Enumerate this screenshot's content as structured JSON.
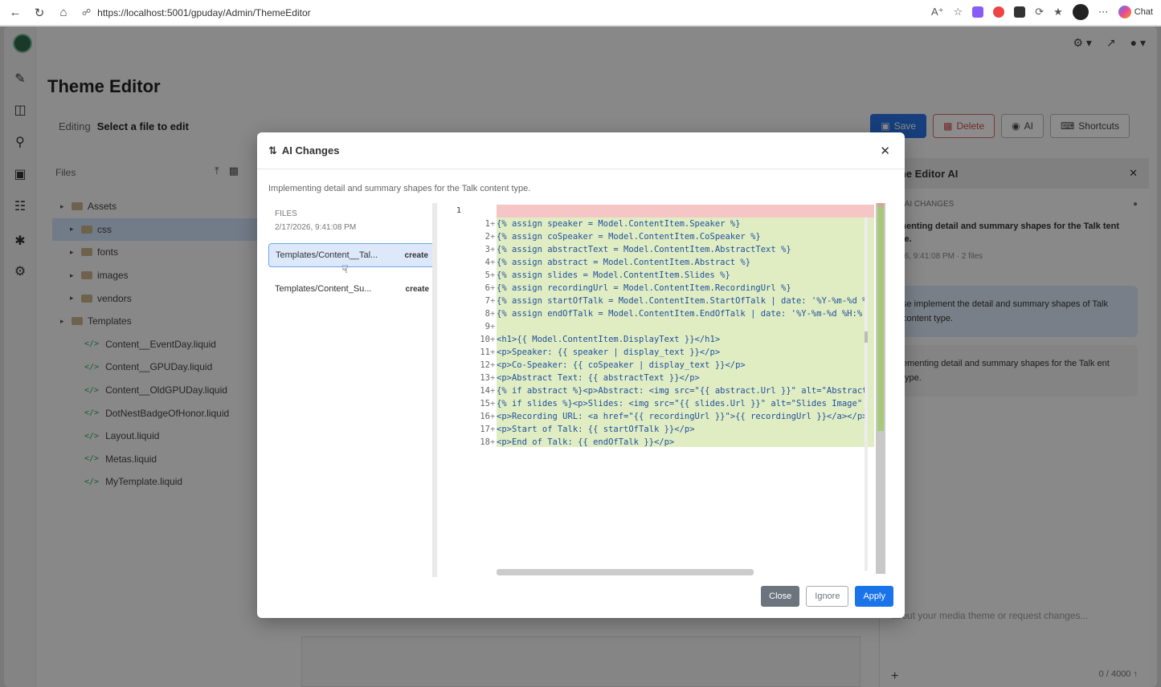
{
  "browser": {
    "url": "https://localhost:5001/gpuday/Admin/ThemeEditor",
    "chat_label": "Chat"
  },
  "app": {
    "page_title": "Theme Editor",
    "editing_label": "Editing",
    "editing_value": "Select a file to edit",
    "files_header": "Files",
    "tree": [
      {
        "label": "Assets",
        "type": "folder",
        "level": 0
      },
      {
        "label": "css",
        "type": "folder",
        "level": 1,
        "active": true
      },
      {
        "label": "fonts",
        "type": "folder",
        "level": 1
      },
      {
        "label": "images",
        "type": "folder",
        "level": 1
      },
      {
        "label": "vendors",
        "type": "folder",
        "level": 1
      },
      {
        "label": "Templates",
        "type": "folder",
        "level": 0
      },
      {
        "label": "Content__EventDay.liquid",
        "type": "file",
        "level": 1
      },
      {
        "label": "Content__GPUDay.liquid",
        "type": "file",
        "level": 1
      },
      {
        "label": "Content__OldGPUDay.liquid",
        "type": "file",
        "level": 1
      },
      {
        "label": "DotNestBadgeOfHonor.liquid",
        "type": "file",
        "level": 1
      },
      {
        "label": "Layout.liquid",
        "type": "file",
        "level": 1
      },
      {
        "label": "Metas.liquid",
        "type": "file",
        "level": 1
      },
      {
        "label": "MyTemplate.liquid",
        "type": "file",
        "level": 1
      }
    ],
    "toolbar": {
      "save": "Save",
      "delete": "Delete",
      "ai": "AI",
      "shortcuts": "Shortcuts"
    },
    "ai_panel": {
      "title": "eme Editor AI",
      "section": "ND AI CHANGES",
      "item_text": "lementing detail and summary shapes for the Talk tent type.",
      "item_ts": "2026, 9:41:08 PM · 2 files",
      "message": "se implement the detail and summary shapes of Talk content type.",
      "response": "ementing detail and summary shapes for the Talk ent type.",
      "input_placeholder": "about your media theme or request changes...",
      "counter": "0 / 4000"
    }
  },
  "modal": {
    "title": "AI Changes",
    "description": "Implementing detail and summary shapes for the Talk content type.",
    "files_label": "FILES",
    "date": "2/17/2026, 9:41:08 PM",
    "files": [
      {
        "name": "Templates/Content__Tal...",
        "action": "create",
        "selected": true
      },
      {
        "name": "Templates/Content_Su...",
        "action": "create",
        "selected": false
      }
    ],
    "original_line": "1",
    "diff_lines": [
      {
        "num": "1",
        "code": "{% assign speaker = Model.ContentItem.Speaker %}"
      },
      {
        "num": "2",
        "code": "{% assign coSpeaker = Model.ContentItem.CoSpeaker %}"
      },
      {
        "num": "3",
        "code": "{% assign abstractText = Model.ContentItem.AbstractText %}"
      },
      {
        "num": "4",
        "code": "{% assign abstract = Model.ContentItem.Abstract %}"
      },
      {
        "num": "5",
        "code": "{% assign slides = Model.ContentItem.Slides %}"
      },
      {
        "num": "6",
        "code": "{% assign recordingUrl = Model.ContentItem.RecordingUrl %}"
      },
      {
        "num": "7",
        "code": "{% assign startOfTalk = Model.ContentItem.StartOfTalk | date: '%Y-%m-%d %"
      },
      {
        "num": "8",
        "code": "{% assign endOfTalk = Model.ContentItem.EndOfTalk | date: '%Y-%m-%d %H:%"
      },
      {
        "num": "9",
        "code": ""
      },
      {
        "num": "10",
        "code": "<h1>{{ Model.ContentItem.DisplayText }}</h1>"
      },
      {
        "num": "11",
        "code": "<p>Speaker: {{ speaker | display_text }}</p>"
      },
      {
        "num": "12",
        "code": "<p>Co-Speaker: {{ coSpeaker | display_text }}</p>"
      },
      {
        "num": "13",
        "code": "<p>Abstract Text: {{ abstractText }}</p>"
      },
      {
        "num": "14",
        "code": "{% if abstract %}<p>Abstract: <img src=\"{{ abstract.Url }}\" alt=\"Abstract"
      },
      {
        "num": "15",
        "code": "{% if slides %}<p>Slides: <img src=\"{{ slides.Url }}\" alt=\"Slides Image\""
      },
      {
        "num": "16",
        "code": "<p>Recording URL: <a href=\"{{ recordingUrl }}\">{{ recordingUrl }}</a></p>"
      },
      {
        "num": "17",
        "code": "<p>Start of Talk: {{ startOfTalk }}</p>"
      },
      {
        "num": "18",
        "code": "<p>End of Talk: {{ endOfTalk }}</p>"
      }
    ],
    "buttons": {
      "close": "Close",
      "ignore": "Ignore",
      "apply": "Apply"
    }
  }
}
